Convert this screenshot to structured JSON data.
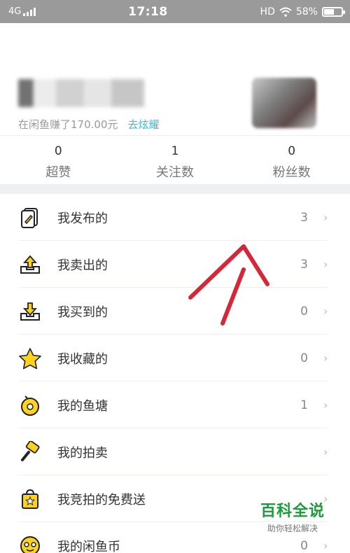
{
  "status_bar": {
    "network": "4G",
    "time": "17:18",
    "hd": "HD",
    "battery": "58%",
    "battery_level": 0.58
  },
  "profile": {
    "earned_text": "在闲鱼赚了170.00元",
    "flaunt_link": "去炫耀"
  },
  "stats": [
    {
      "value": "0",
      "label": "超赞"
    },
    {
      "value": "1",
      "label": "关注数"
    },
    {
      "value": "0",
      "label": "粉丝数"
    }
  ],
  "menu": [
    {
      "label": "我发布的",
      "count": "3",
      "icon": "publish-icon"
    },
    {
      "label": "我卖出的",
      "count": "3",
      "icon": "sold-icon"
    },
    {
      "label": "我买到的",
      "count": "0",
      "icon": "bought-icon"
    },
    {
      "label": "我收藏的",
      "count": "0",
      "icon": "star-icon"
    },
    {
      "label": "我的鱼塘",
      "count": "1",
      "icon": "fishpond-icon"
    },
    {
      "label": "我的拍卖",
      "count": "",
      "icon": "gavel-icon"
    },
    {
      "label": "我竞拍的免费送",
      "count": "",
      "icon": "gift-bag-icon"
    },
    {
      "label": "我的闲鱼币",
      "count": "0",
      "icon": "coin-icon"
    }
  ],
  "watermark": {
    "title": "百科全说",
    "subtitle": "助你轻松解决"
  },
  "colors": {
    "icon_yellow": "#ffd21e",
    "link_blue": "#3fb6d2",
    "arrow_red": "#d4283a",
    "watermark_green": "#1c9b3a"
  }
}
